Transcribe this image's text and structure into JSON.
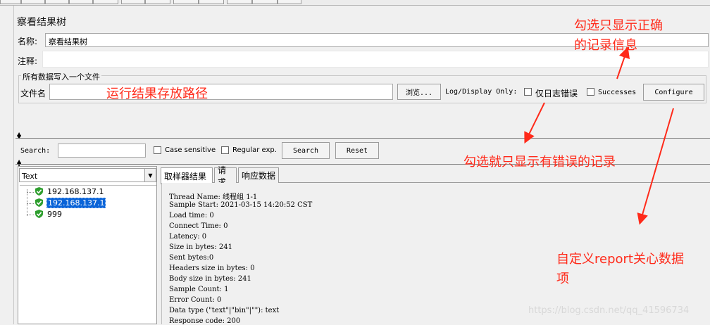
{
  "panel": {
    "title": "察看结果树",
    "name_label": "名称:",
    "name_value": "察看结果树",
    "comment_label": "注释:",
    "file_group_title": "所有数据写入一个文件",
    "file_label": "文件名",
    "browse_label": "浏览...",
    "log_display_label": "Log/Display Only:",
    "errors_only_label": "仅日志错误",
    "successes_label": "Successes",
    "configure_label": "Configure"
  },
  "search": {
    "label": "Search:",
    "case_sensitive_label": "Case sensitive",
    "regex_label": "Regular exp.",
    "search_button": "Search",
    "reset_button": "Reset"
  },
  "tree": {
    "renderer_value": "Text",
    "nodes": [
      {
        "label": "192.168.137.1",
        "selected": false
      },
      {
        "label": "192.168.137.1",
        "selected": true
      },
      {
        "label": "999",
        "selected": false
      }
    ]
  },
  "tabs": [
    "取样器结果",
    "请求",
    "响应数据"
  ],
  "result_lines": [
    "Thread Name: 线程组 1-1",
    "Sample Start: 2021-03-15 14:20:52 CST",
    "Load time: 0",
    "Connect Time: 0",
    "Latency: 0",
    "Size in bytes: 241",
    "Sent bytes:0",
    "Headers size in bytes: 0",
    "Body size in bytes: 241",
    "Sample Count: 1",
    "Error Count: 0",
    "Data type (\"text\"|\"bin\"|\"\"): text",
    "Response code: 200"
  ],
  "annotations": {
    "path_note": "运行结果存放路径",
    "success_note_line1": "勾选只显示正确",
    "success_note_line2": "的记录信息",
    "error_note": "勾选就只显示有错误的记录",
    "report_note_line1": "自定义report关心数据",
    "report_note_line2": "项"
  },
  "watermark": "https://blog.csdn.net/qq_41596734",
  "colors": {
    "annotation_red": "#ff2a1a",
    "selection_blue": "#0a64d8",
    "shield_green": "#2e9e2e"
  }
}
